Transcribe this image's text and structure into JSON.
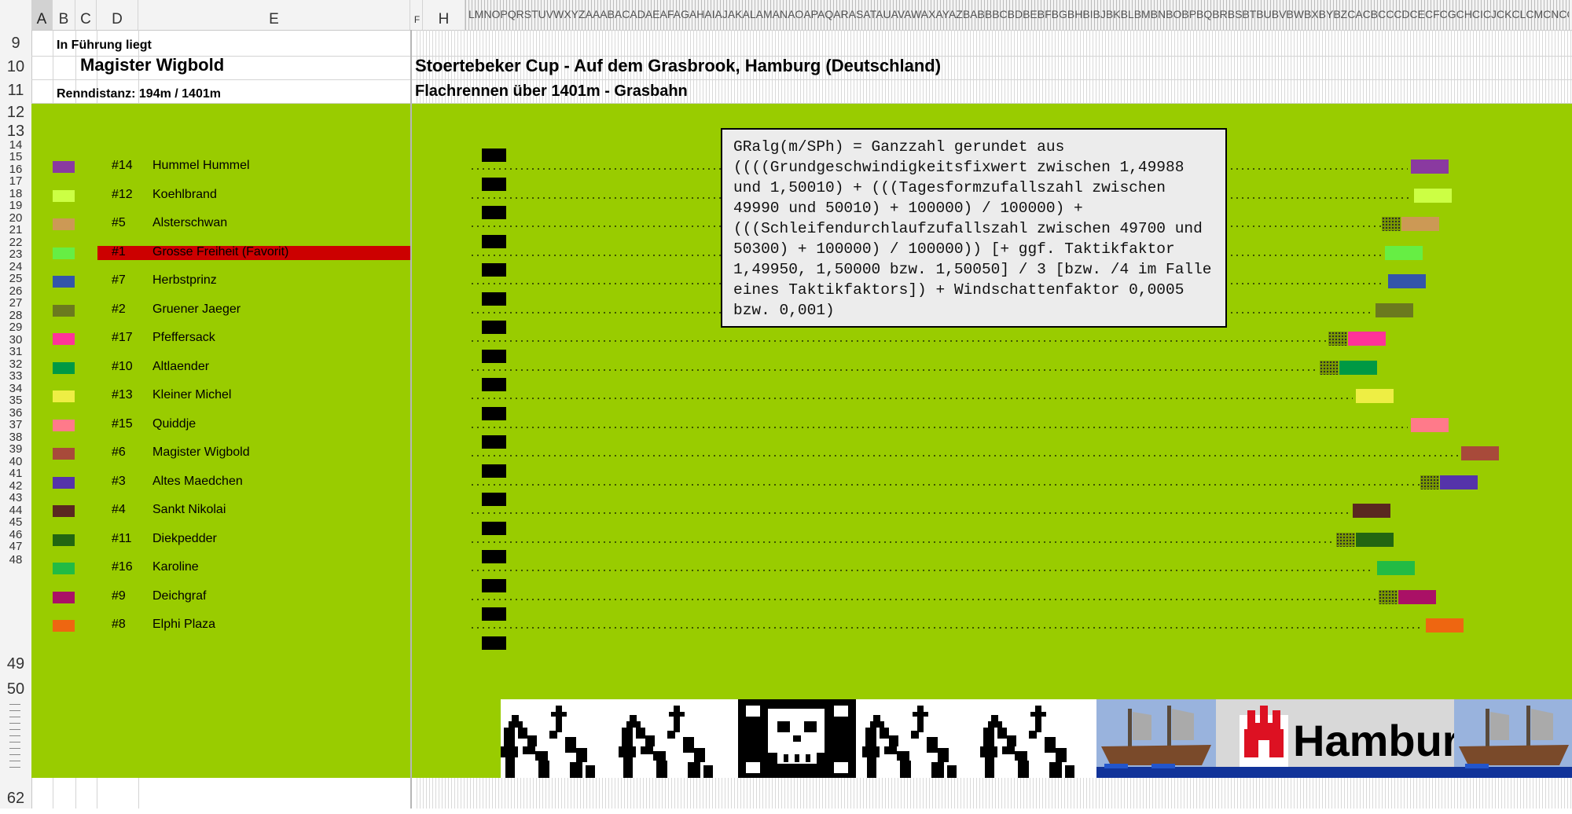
{
  "column_headers": [
    "A",
    "B",
    "C",
    "D",
    "E",
    "F",
    "H"
  ],
  "column_strip_text": "LMNOPQRSTUVWXYZAAABACADAEAFAGAHAIAJAKALAMANAOAPAQARASATAUAVAWAXAYAZBABBBCBDBEBFBGBHBIBJBKBLBMBNBOBPBQBRBSBTBUBVBWBXBYBZCACBCCCDCECFCGCHCICJCKCLCMCNCOCPCQCRCSCTCUCVCWCXCYCZDADBDCDDDEDFDGDH",
  "row_numbers": [
    "9",
    "10",
    "11",
    "12",
    "13",
    "14",
    "15",
    "16",
    "17",
    "18",
    "19",
    "20",
    "21",
    "22",
    "23",
    "24",
    "25",
    "26",
    "27",
    "28",
    "29",
    "30",
    "31",
    "32",
    "33",
    "34",
    "35",
    "36",
    "37",
    "38",
    "39",
    "40",
    "41",
    "42",
    "43",
    "44",
    "45",
    "46",
    "47",
    "48",
    "49",
    "50",
    "62"
  ],
  "leader": {
    "label": "In Führung liegt",
    "name": "Magister Wigbold",
    "distance": "Renndistanz: 194m / 1401m"
  },
  "race": {
    "title": "Stoertebeker Cup  - Auf dem Grasbrook, Hamburg (Deutschland)",
    "subtitle": "Flachrennen über 1401m - Grasbahn"
  },
  "tooltip_text": "GRalg(m/SPh) = Ganzzahl gerundet aus ((((Grundgeschwindigkeitsfixwert zwischen 1,49988 und 1,50010) + (((Tagesformzufallszahl zwischen 49990 und 50010) + 100000) / 100000) + (((Schleifendurchlaufzufallszahl zwischen 49700 und 50300) + 100000) / 100000)) [+ ggf. Taktikfaktor 1,49950, 1,50000 bzw. 1,50050] / 3 [bzw. /4 im Falle eines Taktikfaktors]) + Windschattenfaktor 0,0005 bzw. 0,001)",
  "horses": [
    {
      "num": "#14",
      "name": "Hummel Hummel",
      "color": "#8a3aa0",
      "progress": 0.866,
      "draft": false
    },
    {
      "num": "#12",
      "name": "Koehlbrand",
      "color": "#ccff44",
      "progress": 0.869,
      "draft": false
    },
    {
      "num": "#5",
      "name": "Alsterschwan",
      "color": "#cc9955",
      "progress": 0.857,
      "draft": true
    },
    {
      "num": "#1",
      "name": "Grosse Freiheit (Favorit)",
      "color": "#66ee44",
      "progress": 0.842,
      "draft": false,
      "highlight": true
    },
    {
      "num": "#7",
      "name": "Herbstprinz",
      "color": "#3355aa",
      "progress": 0.845,
      "draft": false
    },
    {
      "num": "#2",
      "name": "Gruener Jaeger",
      "color": "#6b7a1e",
      "progress": 0.833,
      "draft": false
    },
    {
      "num": "#17",
      "name": "Pfeffersack",
      "color": "#ff3399",
      "progress": 0.808,
      "draft": true
    },
    {
      "num": "#10",
      "name": "Altlaender",
      "color": "#009944",
      "progress": 0.8,
      "draft": true
    },
    {
      "num": "#13",
      "name": "Kleiner Michel",
      "color": "#eeee44",
      "progress": 0.815,
      "draft": false
    },
    {
      "num": "#15",
      "name": "Quiddje",
      "color": "#ff7a8a",
      "progress": 0.866,
      "draft": false
    },
    {
      "num": "#6",
      "name": "Magister Wigbold",
      "color": "#a84a3a",
      "progress": 0.912,
      "draft": false
    },
    {
      "num": "#3",
      "name": "Altes Maedchen",
      "color": "#5533aa",
      "progress": 0.893,
      "draft": true
    },
    {
      "num": "#4",
      "name": "Sankt Nikolai",
      "color": "#5a2820",
      "progress": 0.812,
      "draft": false
    },
    {
      "num": "#11",
      "name": "Diekpedder",
      "color": "#226611",
      "progress": 0.815,
      "draft": true
    },
    {
      "num": "#16",
      "name": "Karoline",
      "color": "#22bb44",
      "progress": 0.835,
      "draft": false
    },
    {
      "num": "#9",
      "name": "Deichgraf",
      "color": "#aa1166",
      "progress": 0.854,
      "draft": true
    },
    {
      "num": "#8",
      "name": "Elphi Plaza",
      "color": "#ee6611",
      "progress": 0.88,
      "draft": false
    }
  ],
  "banner": {
    "city_label": "Hamburg",
    "icons": [
      "skull-crossbones-pattern",
      "ship-icon",
      "hamburg-castle-icon",
      "ship-icon"
    ]
  }
}
